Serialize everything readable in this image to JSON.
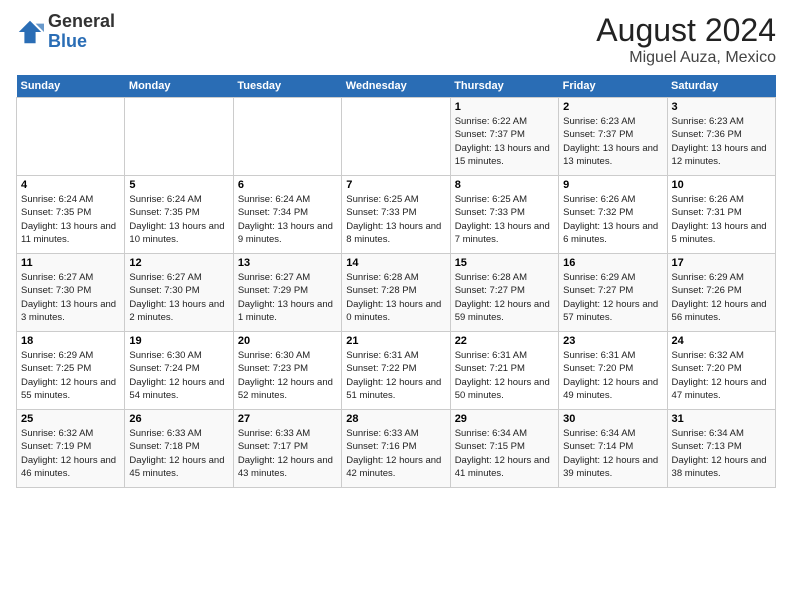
{
  "header": {
    "logo_general": "General",
    "logo_blue": "Blue",
    "main_title": "August 2024",
    "sub_title": "Miguel Auza, Mexico"
  },
  "weekdays": [
    "Sunday",
    "Monday",
    "Tuesday",
    "Wednesday",
    "Thursday",
    "Friday",
    "Saturday"
  ],
  "weeks": [
    [
      {
        "day": "",
        "info": ""
      },
      {
        "day": "",
        "info": ""
      },
      {
        "day": "",
        "info": ""
      },
      {
        "day": "",
        "info": ""
      },
      {
        "day": "1",
        "info": "Sunrise: 6:22 AM\nSunset: 7:37 PM\nDaylight: 13 hours and 15 minutes."
      },
      {
        "day": "2",
        "info": "Sunrise: 6:23 AM\nSunset: 7:37 PM\nDaylight: 13 hours and 13 minutes."
      },
      {
        "day": "3",
        "info": "Sunrise: 6:23 AM\nSunset: 7:36 PM\nDaylight: 13 hours and 12 minutes."
      }
    ],
    [
      {
        "day": "4",
        "info": "Sunrise: 6:24 AM\nSunset: 7:35 PM\nDaylight: 13 hours and 11 minutes."
      },
      {
        "day": "5",
        "info": "Sunrise: 6:24 AM\nSunset: 7:35 PM\nDaylight: 13 hours and 10 minutes."
      },
      {
        "day": "6",
        "info": "Sunrise: 6:24 AM\nSunset: 7:34 PM\nDaylight: 13 hours and 9 minutes."
      },
      {
        "day": "7",
        "info": "Sunrise: 6:25 AM\nSunset: 7:33 PM\nDaylight: 13 hours and 8 minutes."
      },
      {
        "day": "8",
        "info": "Sunrise: 6:25 AM\nSunset: 7:33 PM\nDaylight: 13 hours and 7 minutes."
      },
      {
        "day": "9",
        "info": "Sunrise: 6:26 AM\nSunset: 7:32 PM\nDaylight: 13 hours and 6 minutes."
      },
      {
        "day": "10",
        "info": "Sunrise: 6:26 AM\nSunset: 7:31 PM\nDaylight: 13 hours and 5 minutes."
      }
    ],
    [
      {
        "day": "11",
        "info": "Sunrise: 6:27 AM\nSunset: 7:30 PM\nDaylight: 13 hours and 3 minutes."
      },
      {
        "day": "12",
        "info": "Sunrise: 6:27 AM\nSunset: 7:30 PM\nDaylight: 13 hours and 2 minutes."
      },
      {
        "day": "13",
        "info": "Sunrise: 6:27 AM\nSunset: 7:29 PM\nDaylight: 13 hours and 1 minute."
      },
      {
        "day": "14",
        "info": "Sunrise: 6:28 AM\nSunset: 7:28 PM\nDaylight: 13 hours and 0 minutes."
      },
      {
        "day": "15",
        "info": "Sunrise: 6:28 AM\nSunset: 7:27 PM\nDaylight: 12 hours and 59 minutes."
      },
      {
        "day": "16",
        "info": "Sunrise: 6:29 AM\nSunset: 7:27 PM\nDaylight: 12 hours and 57 minutes."
      },
      {
        "day": "17",
        "info": "Sunrise: 6:29 AM\nSunset: 7:26 PM\nDaylight: 12 hours and 56 minutes."
      }
    ],
    [
      {
        "day": "18",
        "info": "Sunrise: 6:29 AM\nSunset: 7:25 PM\nDaylight: 12 hours and 55 minutes."
      },
      {
        "day": "19",
        "info": "Sunrise: 6:30 AM\nSunset: 7:24 PM\nDaylight: 12 hours and 54 minutes."
      },
      {
        "day": "20",
        "info": "Sunrise: 6:30 AM\nSunset: 7:23 PM\nDaylight: 12 hours and 52 minutes."
      },
      {
        "day": "21",
        "info": "Sunrise: 6:31 AM\nSunset: 7:22 PM\nDaylight: 12 hours and 51 minutes."
      },
      {
        "day": "22",
        "info": "Sunrise: 6:31 AM\nSunset: 7:21 PM\nDaylight: 12 hours and 50 minutes."
      },
      {
        "day": "23",
        "info": "Sunrise: 6:31 AM\nSunset: 7:20 PM\nDaylight: 12 hours and 49 minutes."
      },
      {
        "day": "24",
        "info": "Sunrise: 6:32 AM\nSunset: 7:20 PM\nDaylight: 12 hours and 47 minutes."
      }
    ],
    [
      {
        "day": "25",
        "info": "Sunrise: 6:32 AM\nSunset: 7:19 PM\nDaylight: 12 hours and 46 minutes."
      },
      {
        "day": "26",
        "info": "Sunrise: 6:33 AM\nSunset: 7:18 PM\nDaylight: 12 hours and 45 minutes."
      },
      {
        "day": "27",
        "info": "Sunrise: 6:33 AM\nSunset: 7:17 PM\nDaylight: 12 hours and 43 minutes."
      },
      {
        "day": "28",
        "info": "Sunrise: 6:33 AM\nSunset: 7:16 PM\nDaylight: 12 hours and 42 minutes."
      },
      {
        "day": "29",
        "info": "Sunrise: 6:34 AM\nSunset: 7:15 PM\nDaylight: 12 hours and 41 minutes."
      },
      {
        "day": "30",
        "info": "Sunrise: 6:34 AM\nSunset: 7:14 PM\nDaylight: 12 hours and 39 minutes."
      },
      {
        "day": "31",
        "info": "Sunrise: 6:34 AM\nSunset: 7:13 PM\nDaylight: 12 hours and 38 minutes."
      }
    ]
  ]
}
